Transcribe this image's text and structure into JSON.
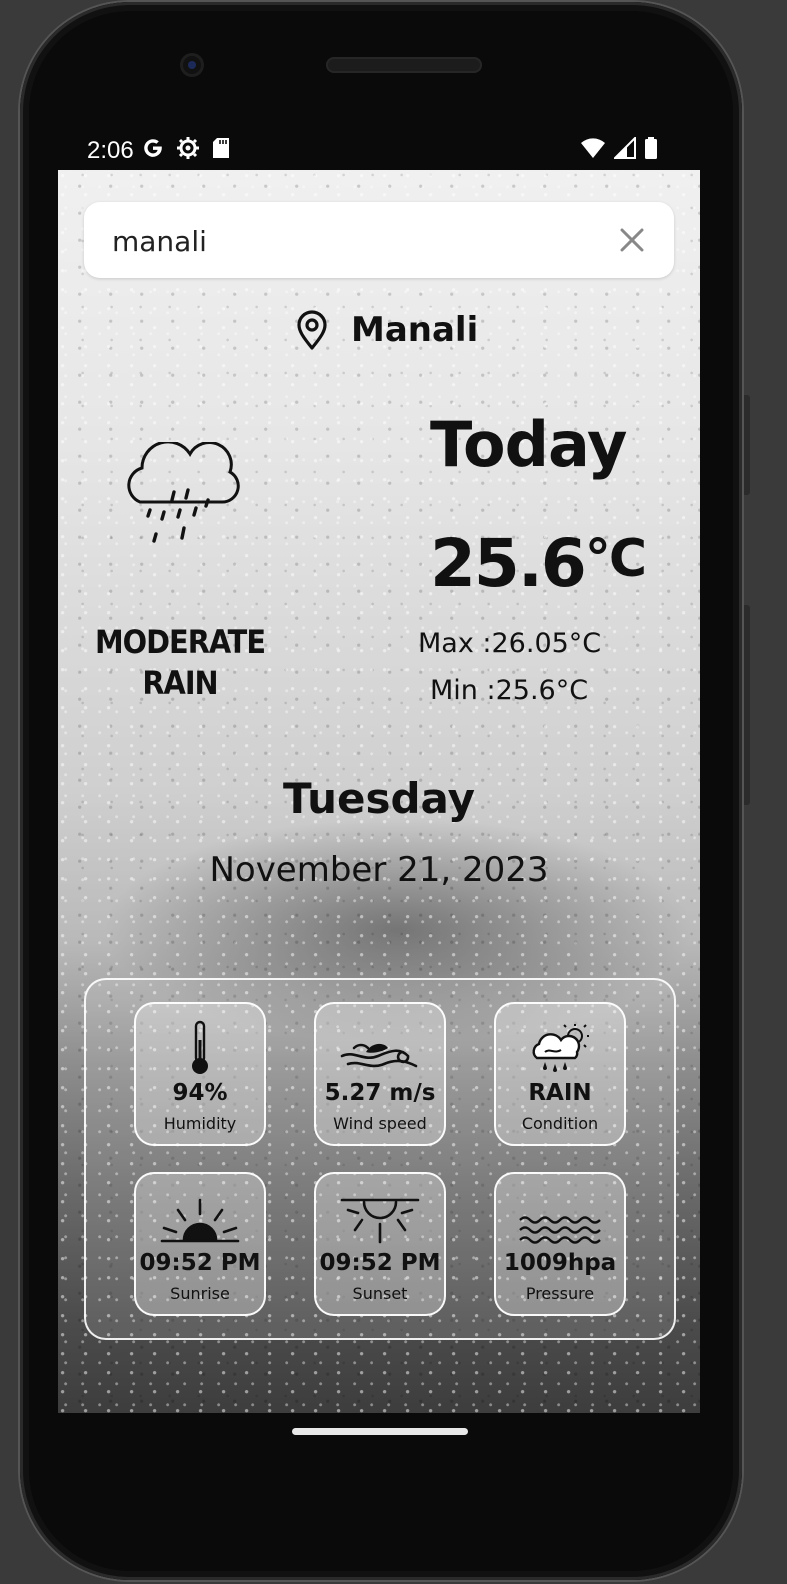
{
  "status_bar": {
    "time": "2:06"
  },
  "search": {
    "value": "manali"
  },
  "location": {
    "name": "Manali"
  },
  "weather": {
    "condition": "MODERATE RAIN",
    "heading": "Today",
    "temperature": "25.6",
    "temperature_unit": "°C",
    "max": "Max :26.05°C",
    "min": "Min :25.6°C"
  },
  "date_info": {
    "day": "Tuesday",
    "date": "November 21, 2023"
  },
  "details": [
    {
      "value": "94%",
      "label": "Humidity",
      "icon": "thermometer-icon"
    },
    {
      "value": "5.27 m/s",
      "label": "Wind speed",
      "icon": "wind-icon"
    },
    {
      "value": "RAIN",
      "label": "Condition",
      "icon": "rain-cloud-sun-icon"
    },
    {
      "value": "09:52 PM",
      "label": "Sunrise",
      "icon": "sunrise-icon"
    },
    {
      "value": "09:52 PM",
      "label": "Sunset",
      "icon": "sunset-icon"
    },
    {
      "value": "1009hpa",
      "label": "Pressure",
      "icon": "waves-icon"
    }
  ],
  "colors": {
    "text": "#111111",
    "card_border": "#ffffff",
    "search_bg": "#ffffff"
  }
}
